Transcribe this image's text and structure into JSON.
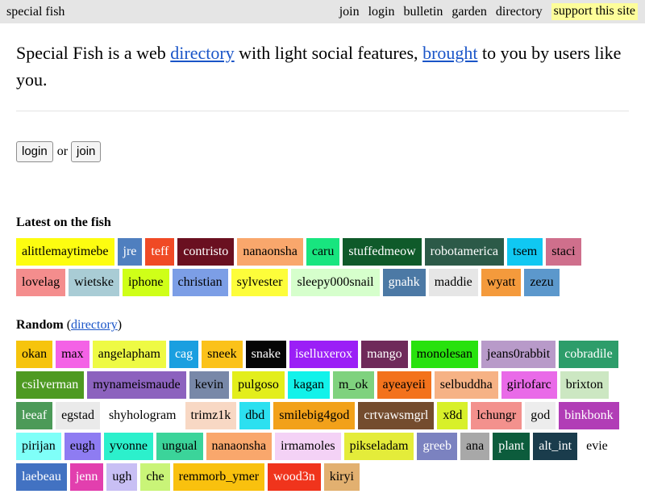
{
  "topbar": {
    "brand": "special fish",
    "nav": [
      {
        "label": "join",
        "name": "nav-join"
      },
      {
        "label": "login",
        "name": "nav-login"
      },
      {
        "label": "bulletin",
        "name": "nav-bulletin"
      },
      {
        "label": "garden",
        "name": "nav-garden"
      },
      {
        "label": "directory",
        "name": "nav-directory"
      }
    ],
    "support": "support this site"
  },
  "intro": {
    "part1": "Special Fish is a web ",
    "link1": "directory",
    "part2": " with light social features, ",
    "link2": "brought",
    "part3": " to you by users like you."
  },
  "auth": {
    "login": "login",
    "or": "or",
    "join": "join"
  },
  "latest": {
    "heading": "Latest on the fish",
    "users": [
      {
        "name": "alittlemaytimebe",
        "bg": "#fdfd10",
        "fg": "#000000"
      },
      {
        "name": "jre",
        "bg": "#4f7fbf",
        "fg": "#ffffff"
      },
      {
        "name": "teff",
        "bg": "#f04a25",
        "fg": "#ffffff"
      },
      {
        "name": "contristo",
        "bg": "#6a1020",
        "fg": "#ffffff"
      },
      {
        "name": "nanaonsha",
        "bg": "#f9a76c",
        "fg": "#000000"
      },
      {
        "name": "caru",
        "bg": "#18e57f",
        "fg": "#000000"
      },
      {
        "name": "stuffedmeow",
        "bg": "#0f5a2a",
        "fg": "#ffffff"
      },
      {
        "name": "robotamerica",
        "bg": "#2c5a48",
        "fg": "#ffffff"
      },
      {
        "name": "tsem",
        "bg": "#10c8f2",
        "fg": "#000000"
      },
      {
        "name": "staci",
        "bg": "#cf6f8c",
        "fg": "#000000"
      },
      {
        "name": "lovelag",
        "bg": "#f48d8d",
        "fg": "#000000"
      },
      {
        "name": "wietske",
        "bg": "#a9ccd5",
        "fg": "#000000"
      },
      {
        "name": "iphone",
        "bg": "#cfff18",
        "fg": "#000000"
      },
      {
        "name": "christian",
        "bg": "#7c9ee6",
        "fg": "#000000"
      },
      {
        "name": "sylvester",
        "bg": "#fdfd3a",
        "fg": "#000000"
      },
      {
        "name": "sleepy000snail",
        "bg": "#d6ffcc",
        "fg": "#000000"
      },
      {
        "name": "gnahk",
        "bg": "#4c79a5",
        "fg": "#ffffff"
      },
      {
        "name": "maddie",
        "bg": "#e6e6e6",
        "fg": "#000000"
      },
      {
        "name": "wyatt",
        "bg": "#f49a3c",
        "fg": "#000000"
      },
      {
        "name": "zezu",
        "bg": "#5c98cc",
        "fg": "#000000"
      }
    ]
  },
  "random": {
    "heading": "Random",
    "open": " (",
    "link": "directory",
    "close": ")",
    "users": [
      {
        "name": "okan",
        "bg": "#f6c40d",
        "fg": "#000000"
      },
      {
        "name": "max",
        "bg": "#f462e6",
        "fg": "#000000"
      },
      {
        "name": "angelapham",
        "bg": "#eefa44",
        "fg": "#000000"
      },
      {
        "name": "cag",
        "bg": "#1a9fe0",
        "fg": "#ffffff"
      },
      {
        "name": "sneek",
        "bg": "#fbc21a",
        "fg": "#000000"
      },
      {
        "name": "snake",
        "bg": "#050505",
        "fg": "#ffffff"
      },
      {
        "name": "iselluxerox",
        "bg": "#9b1ff6",
        "fg": "#ffffff"
      },
      {
        "name": "mango",
        "bg": "#6f2a5a",
        "fg": "#ffffff"
      },
      {
        "name": "monolesan",
        "bg": "#28e20e",
        "fg": "#000000"
      },
      {
        "name": "jeans0rabbit",
        "bg": "#b89ac9",
        "fg": "#000000"
      },
      {
        "name": "cobradile",
        "bg": "#2d9d6a",
        "fg": "#ffffff"
      },
      {
        "name": "csilverman",
        "bg": "#4e9a22",
        "fg": "#ffffff"
      },
      {
        "name": "mynameismaude",
        "bg": "#8c62be",
        "fg": "#000000"
      },
      {
        "name": "kevin",
        "bg": "#7888a8",
        "fg": "#000000"
      },
      {
        "name": "pulgoso",
        "bg": "#e3ee1c",
        "fg": "#000000"
      },
      {
        "name": "kagan",
        "bg": "#12f2ea",
        "fg": "#000000"
      },
      {
        "name": "m_ok",
        "bg": "#7fd27e",
        "fg": "#000000"
      },
      {
        "name": "ayeayeii",
        "bg": "#f3721c",
        "fg": "#000000"
      },
      {
        "name": "selbuddha",
        "bg": "#f6b285",
        "fg": "#000000"
      },
      {
        "name": "girlofarc",
        "bg": "#e96ae8",
        "fg": "#000000"
      },
      {
        "name": "brixton",
        "bg": "#cce7c2",
        "fg": "#000000"
      },
      {
        "name": "leeaf",
        "bg": "#4c9a58",
        "fg": "#ffffff"
      },
      {
        "name": "egstad",
        "bg": "#eaeaea",
        "fg": "#000000"
      },
      {
        "name": "shyhologram",
        "bg": "#ffffff",
        "fg": "#000000"
      },
      {
        "name": "trimz1k",
        "bg": "#f8d8c4",
        "fg": "#000000"
      },
      {
        "name": "dbd",
        "bg": "#2ce0f0",
        "fg": "#000000"
      },
      {
        "name": "smilebig4god",
        "bg": "#f2a11a",
        "fg": "#000000"
      },
      {
        "name": "crtvawsmgrl",
        "bg": "#744c2e",
        "fg": "#ffffff"
      },
      {
        "name": "x8d",
        "bg": "#d8f02a",
        "fg": "#000000"
      },
      {
        "name": "lchungr",
        "bg": "#f3918d",
        "fg": "#000000"
      },
      {
        "name": "god",
        "bg": "#ededed",
        "fg": "#000000"
      },
      {
        "name": "binkbonk",
        "bg": "#b13db6",
        "fg": "#ffffff"
      },
      {
        "name": "pirijan",
        "bg": "#7ffff8",
        "fg": "#000000"
      },
      {
        "name": "eugh",
        "bg": "#8e7cf2",
        "fg": "#000000"
      },
      {
        "name": "yvonne",
        "bg": "#2cf0cc",
        "fg": "#000000"
      },
      {
        "name": "ungual",
        "bg": "#3bd49a",
        "fg": "#000000"
      },
      {
        "name": "nanaonsha",
        "bg": "#f9a76c",
        "fg": "#000000"
      },
      {
        "name": "irmamoles",
        "bg": "#f4d2f6",
        "fg": "#000000"
      },
      {
        "name": "pikseladam",
        "bg": "#e4ec3a",
        "fg": "#000000"
      },
      {
        "name": "greeb",
        "bg": "#7b82c0",
        "fg": "#ffffff"
      },
      {
        "name": "ana",
        "bg": "#a8a8a8",
        "fg": "#000000"
      },
      {
        "name": "plant",
        "bg": "#0c5c3c",
        "fg": "#ffffff"
      },
      {
        "name": "alt_int",
        "bg": "#1a3c4c",
        "fg": "#ffffff"
      },
      {
        "name": "evie",
        "bg": "#ffffff",
        "fg": "#000000"
      },
      {
        "name": "laebeau",
        "bg": "#4272c2",
        "fg": "#ffffff"
      },
      {
        "name": "jenn",
        "bg": "#e23fae",
        "fg": "#ffffff"
      },
      {
        "name": "ugh",
        "bg": "#c8bff4",
        "fg": "#000000"
      },
      {
        "name": "che",
        "bg": "#c9f478",
        "fg": "#000000"
      },
      {
        "name": "remmorb_ymer",
        "bg": "#f9c10e",
        "fg": "#000000"
      },
      {
        "name": "wood3n",
        "bg": "#f0341c",
        "fg": "#ffffff"
      },
      {
        "name": "kiryi",
        "bg": "#e2b070",
        "fg": "#000000"
      }
    ]
  }
}
